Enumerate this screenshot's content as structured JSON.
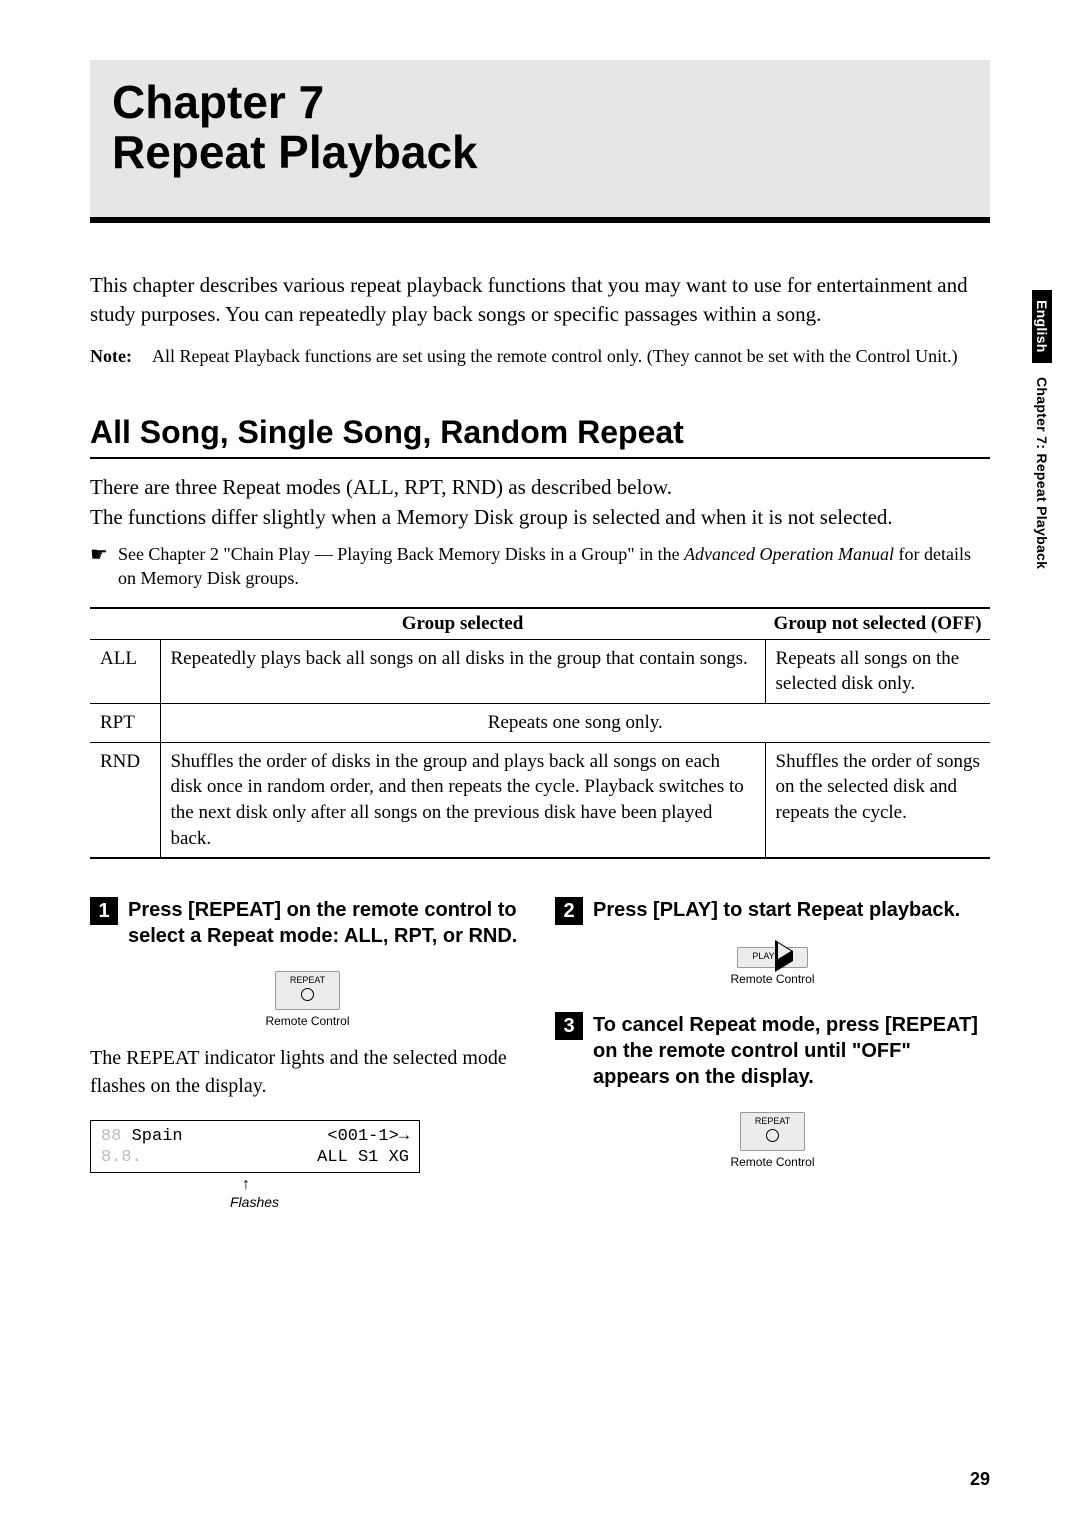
{
  "chapter": {
    "label": "Chapter 7",
    "title": "Repeat Playback"
  },
  "side": {
    "lang": "English",
    "chap": "Chapter 7:  Repeat Playback"
  },
  "intro": "This chapter describes various repeat playback functions that you may want to use for entertainment and study purposes. You can repeatedly play back songs or specific passages within a song.",
  "note": {
    "label": "Note:",
    "body": "All Repeat Playback functions are set using the remote control only. (They cannot be set with the Control Unit.)"
  },
  "section": {
    "heading": "All Song, Single Song, Random Repeat",
    "line1": "There are three Repeat modes (ALL, RPT, RND) as described below.",
    "line2": "The functions differ slightly when a Memory Disk group is selected and when it is not selected.",
    "ref_pre": "See Chapter 2 \"Chain Play — Playing Back Memory Disks in a Group\" in the ",
    "ref_ital": "Advanced Operation Manual",
    "ref_post": " for details on Memory Disk groups."
  },
  "table": {
    "head1": "Group selected",
    "head2": "Group not selected (OFF)",
    "rows": {
      "all": {
        "label": "ALL",
        "c1": "Repeatedly plays back all songs on all disks in the group that contain songs.",
        "c2": "Repeats all songs on the selected disk only."
      },
      "rpt": {
        "label": "RPT",
        "span": "Repeats one song only."
      },
      "rnd": {
        "label": "RND",
        "c1": "Shuffles the order of disks in the group and plays back all songs on each disk once in random order, and then repeats the cycle. Playback switches to the next disk only after all songs on the previous disk have been played back.",
        "c2": "Shuffles the order of songs on the selected disk and repeats the cycle."
      }
    }
  },
  "steps": {
    "s1": {
      "num": "1",
      "title": "Press [REPEAT] on the remote control to select a Repeat mode: ALL, RPT, or RND.",
      "body": "The REPEAT indicator lights and the selected mode flashes on the display."
    },
    "s2": {
      "num": "2",
      "title": "Press [PLAY] to start Repeat playback."
    },
    "s3": {
      "num": "3",
      "title": "To cancel Repeat mode, press [REPEAT] on the remote control until \"OFF\" appears on the display."
    },
    "repeat_label": "REPEAT",
    "play_label": "PLAY",
    "rc_caption": "Remote Control"
  },
  "display": {
    "dim1": "88",
    "song": "Spain",
    "right1": "<001-1>→",
    "dim2": "8.8.",
    "status": "ALL S1 XG",
    "flashes": "Flashes"
  },
  "page_number": "29"
}
